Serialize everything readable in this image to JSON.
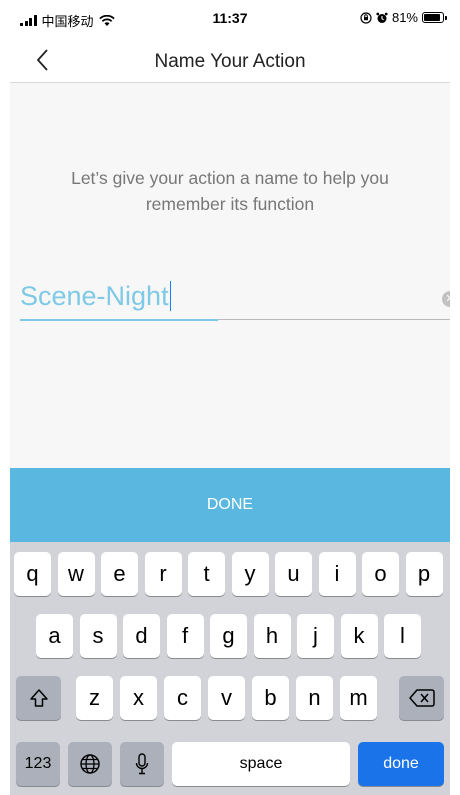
{
  "status_bar": {
    "carrier": "中国移动",
    "time": "11:37",
    "battery_percent": "81%"
  },
  "nav": {
    "title": "Name Your Action",
    "back_icon": "chevron-left-icon"
  },
  "content": {
    "prompt": "Let’s give your action a name to help you remember its function",
    "name_value": "Scene-Night",
    "clear_icon": "clear-circle-icon"
  },
  "done_button": {
    "label": "DONE"
  },
  "keyboard": {
    "row1": [
      "q",
      "w",
      "e",
      "r",
      "t",
      "y",
      "u",
      "i",
      "o",
      "p"
    ],
    "row2": [
      "a",
      "s",
      "d",
      "f",
      "g",
      "h",
      "j",
      "k",
      "l"
    ],
    "row3": [
      "z",
      "x",
      "c",
      "v",
      "b",
      "n",
      "m"
    ],
    "numbers_label": "123",
    "space_label": "space",
    "return_label": "done",
    "accent_color": "#1a73e8"
  },
  "colors": {
    "done_bar": "#5ab8e0",
    "field_text": "#7ec9e5"
  }
}
